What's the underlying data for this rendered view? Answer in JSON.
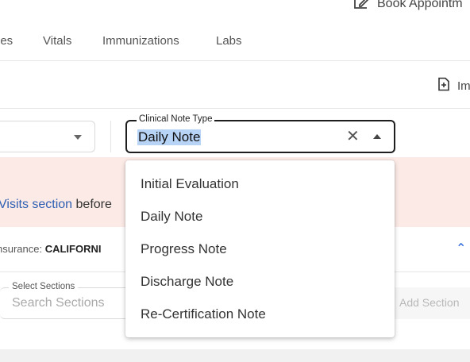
{
  "header": {
    "book_appointment_label": "Book Appointm",
    "book_icon": "edit-calendar-icon"
  },
  "tabs": [
    {
      "label": "ies"
    },
    {
      "label": "Vitals"
    },
    {
      "label": "Immunizations"
    },
    {
      "label": "Labs"
    }
  ],
  "toolbar": {
    "import_label": "Im",
    "import_icon": "add-document-icon"
  },
  "note_type_field": {
    "legend": "Clinical Note Type",
    "value": "Daily Note",
    "clear_icon": "close-icon",
    "toggle_icon": "caret-up-icon"
  },
  "left_select": {
    "toggle_icon": "caret-down-icon"
  },
  "alert": {
    "link_text": "Visits section",
    "text_after": " before"
  },
  "insurance": {
    "label": "nsurance:",
    "value": "CALIFORNI"
  },
  "sections_field": {
    "legend": "Select Sections",
    "placeholder": "Search Sections"
  },
  "add_section_label": "Add Section",
  "dropdown": {
    "options": [
      {
        "label": "Initial Evaluation"
      },
      {
        "label": "Daily Note"
      },
      {
        "label": "Progress Note"
      },
      {
        "label": "Discharge Note"
      },
      {
        "label": "Re-Certification Note"
      }
    ]
  },
  "colors": {
    "alert_bg": "#fbeae6",
    "link": "#2f5fb3",
    "selection_highlight": "#b7d3f6",
    "accent": "#2c68d8"
  }
}
